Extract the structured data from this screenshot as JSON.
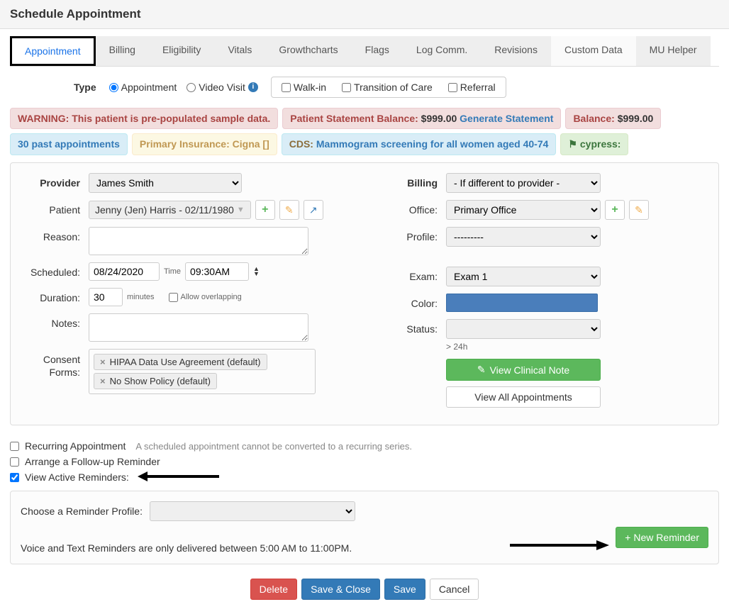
{
  "header": {
    "title": "Schedule Appointment"
  },
  "tabs": {
    "items": [
      "Appointment",
      "Billing",
      "Eligibility",
      "Vitals",
      "Growthcharts",
      "Flags",
      "Log Comm.",
      "Revisions",
      "Custom Data",
      "MU Helper"
    ],
    "active": 0
  },
  "type_row": {
    "label": "Type",
    "radio_appointment": "Appointment",
    "radio_video": "Video Visit",
    "chk_walkin": "Walk-in",
    "chk_transition": "Transition of Care",
    "chk_referral": "Referral"
  },
  "badges": {
    "warning": "WARNING: This patient is pre-populated sample data.",
    "stmt_label": "Patient Statement Balance: ",
    "stmt_amt": "$999.00",
    "stmt_link": "Generate Statement",
    "bal_label": "Balance: ",
    "bal_amt": "$999.00",
    "past": "30 past appointments",
    "insurance": "Primary Insurance: Cigna []",
    "cds_pre": "CDS: ",
    "cds_txt": "Mammogram screening for all women aged 40-74",
    "flag": "cypress:"
  },
  "left": {
    "provider": {
      "label": "Provider",
      "value": "James Smith"
    },
    "patient": {
      "label": "Patient",
      "value": "Jenny (Jen) Harris - 02/11/1980"
    },
    "reason": {
      "label": "Reason:"
    },
    "scheduled": {
      "label": "Scheduled:",
      "date": "08/24/2020",
      "time_label": "Time",
      "time": "09:30AM"
    },
    "duration": {
      "label": "Duration:",
      "value": "30",
      "unit": "minutes",
      "overlap": "Allow overlapping"
    },
    "notes": {
      "label": "Notes:"
    },
    "consent": {
      "label": "Consent Forms:",
      "items": [
        "HIPAA Data Use Agreement (default)",
        "No Show Policy (default)"
      ]
    }
  },
  "right": {
    "billing": {
      "label": "Billing",
      "value": "- If different to provider -"
    },
    "office": {
      "label": "Office:",
      "value": "Primary Office"
    },
    "profile": {
      "label": "Profile:",
      "value": "---------"
    },
    "exam": {
      "label": "Exam:",
      "value": "Exam 1"
    },
    "color": {
      "label": "Color:",
      "hex": "#4a7ebb"
    },
    "status": {
      "label": "Status:",
      "value": "",
      "sub": "> 24h"
    },
    "view_note": "View Clinical Note",
    "view_all": "View All Appointments"
  },
  "checks": {
    "recurring": {
      "label": "Recurring Appointment",
      "help": "A scheduled appointment cannot be converted to a recurring series.",
      "checked": false
    },
    "followup": {
      "label": "Arrange a Follow-up Reminder",
      "checked": false
    },
    "view_active": {
      "label": "View Active Reminders:",
      "checked": true
    }
  },
  "reminder": {
    "choose_label": "Choose a Reminder Profile:",
    "note": "Voice and Text Reminders are only delivered between 5:00 AM to 11:00PM.",
    "new_btn": "New Reminder"
  },
  "footer": {
    "delete": "Delete",
    "save_close": "Save & Close",
    "save": "Save",
    "cancel": "Cancel"
  }
}
